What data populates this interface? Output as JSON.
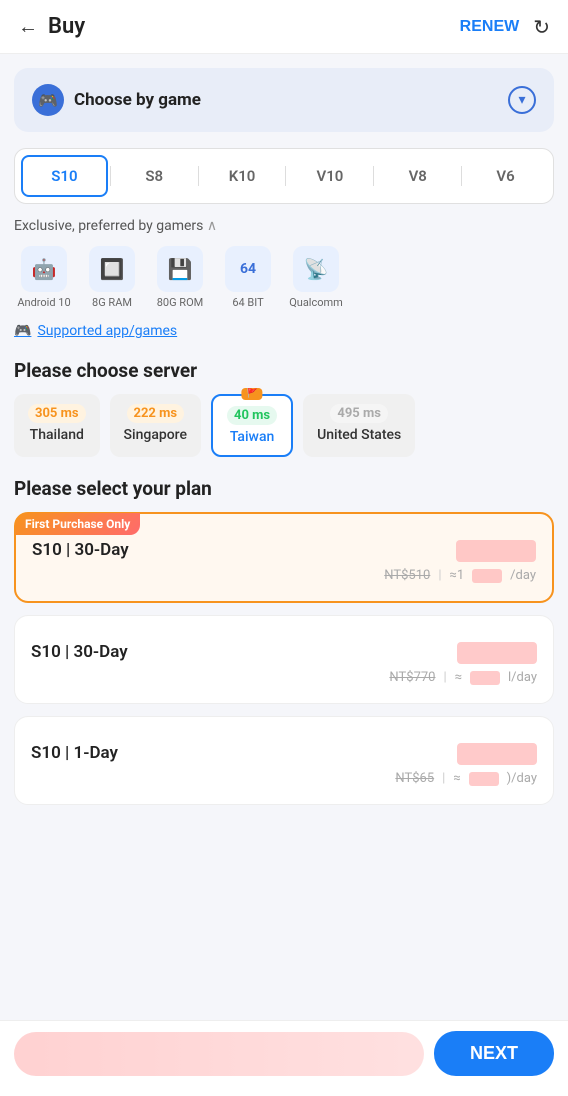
{
  "header": {
    "back_label": "←",
    "title": "Buy",
    "renew_label": "RENEW"
  },
  "choose_game": {
    "label": "Choose by game"
  },
  "plan_tabs": {
    "items": [
      "S10",
      "S8",
      "K10",
      "V10",
      "V8",
      "V6"
    ],
    "active_index": 0
  },
  "exclusive_label": "Exclusive, preferred by gamers",
  "specs": [
    {
      "icon": "🤖",
      "label": "Android 10"
    },
    {
      "icon": "💾",
      "label": "8G RAM"
    },
    {
      "icon": "🗂️",
      "label": "80G ROM"
    },
    {
      "icon": "64",
      "label": "64 BIT"
    },
    {
      "icon": "📱",
      "label": "Qualcomm"
    }
  ],
  "supported_link": "Supported app/games",
  "server_section": {
    "title": "Please choose server",
    "servers": [
      {
        "name": "Thailand",
        "ping": "305 ms",
        "ping_class": "ping-orange",
        "active": false
      },
      {
        "name": "Singapore",
        "ping": "222 ms",
        "ping_class": "ping-orange",
        "active": false
      },
      {
        "name": "Taiwan",
        "ping": "40 ms",
        "ping_class": "ping-green",
        "active": true,
        "badge": "🚩"
      },
      {
        "name": "United States",
        "ping": "495 ms",
        "ping_class": "ping-gray",
        "active": false
      }
    ]
  },
  "plan_section": {
    "title": "Please select your plan",
    "plans": [
      {
        "name": "S10 | 30-Day",
        "featured": true,
        "badge": "First Purchase Only",
        "original_price": "NT$510",
        "approx": "≈1",
        "per_day": "/day"
      },
      {
        "name": "S10 | 30-Day",
        "featured": false,
        "original_price": "NT$770",
        "approx": "≈",
        "per_day": "l/day"
      },
      {
        "name": "S10 | 1-Day",
        "featured": false,
        "original_price": "NT$65",
        "approx": "≈",
        "per_day": ")/day"
      }
    ]
  },
  "bottom": {
    "next_label": "NEXT"
  }
}
